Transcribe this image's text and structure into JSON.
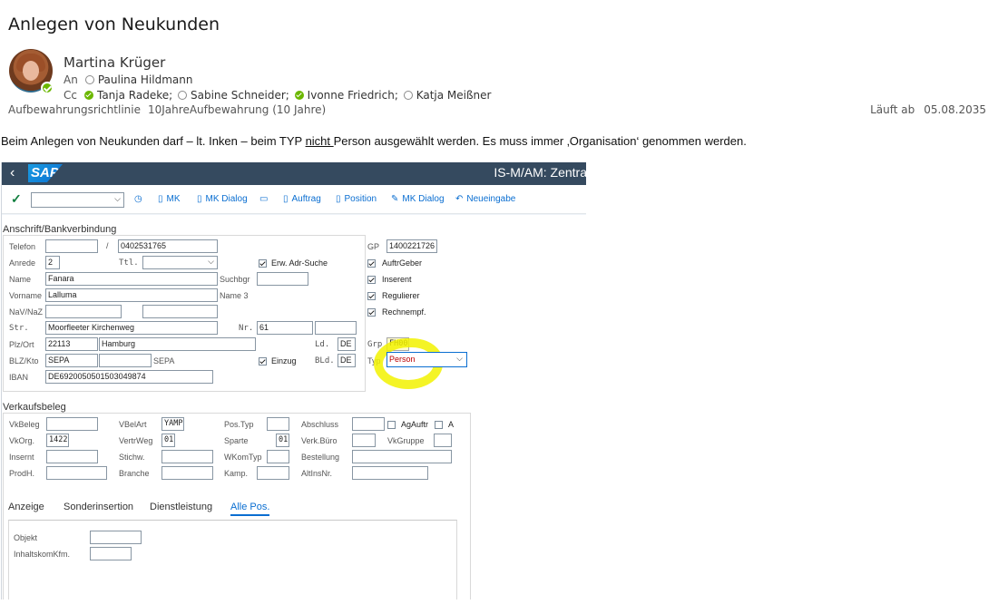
{
  "mail": {
    "subject": "Anlegen von Neukunden",
    "sender": "Martina Krüger",
    "to_label": "An",
    "cc_label": "Cc",
    "to": [
      {
        "name": "Paulina Hildmann",
        "status": "offline"
      }
    ],
    "cc": [
      {
        "name": "Tanja Radeke;",
        "status": "available"
      },
      {
        "name": "Sabine Schneider;",
        "status": "offline"
      },
      {
        "name": "Ivonne Friedrich;",
        "status": "available"
      },
      {
        "name": "Katja Meißner",
        "status": "offline"
      }
    ],
    "retention_label": "Aufbewahrungsrichtlinie",
    "retention_value": "10JahreAufbewahrung (10 Jahre)",
    "expiry_label": "Läuft ab",
    "expiry_date": "05.08.2035",
    "body_part1": "Beim Anlegen von Neukunden darf – lt. Inken – beim TYP ",
    "body_underlined": "nicht ",
    "body_part2": "Person ausgewählt werden. Es muss immer ‚Organisation‘ genommen werden."
  },
  "sap": {
    "logo": "SAP",
    "title": "IS-M/AM: Zentra",
    "toolbar": {
      "mk": "MK",
      "mk_dialog": "MK Dialog",
      "auftrag": "Auftrag",
      "position": "Position",
      "mk_dialog2": "MK Dialog",
      "neueingabe": "Neueingabe"
    },
    "address": {
      "section_title": "Anschrift/Bankverbindung",
      "telefon_label": "Telefon",
      "telefon_sep": "/",
      "telefon_value": "0402531765",
      "anrede_label": "Anrede",
      "anrede_value": "2",
      "ttl_label": "Ttl.",
      "erw_adr_suche": "Erw. Adr-Suche",
      "name_label": "Name",
      "name_value": "Fanara",
      "suchbgr_label": "Suchbgr",
      "vorname_label": "Vorname",
      "vorname_value": "Lalluma",
      "name3_label": "Name 3",
      "navnaz_label": "NaV/NaZ",
      "str_label": "Str.",
      "str_value": "Moorfleeter Kirchenweg",
      "nr_label": "Nr.",
      "nr_value": "61",
      "plzort_label": "Plz/Ort",
      "plz_value": "22113",
      "ort_value": "Hamburg",
      "ld_label": "Ld.",
      "ld_value": "DE",
      "blzkto_label": "BLZ/Kto",
      "blz_value": "SEPA",
      "sepa_label": "SEPA",
      "einzug_label": "Einzug",
      "bld_label": "BLd.",
      "bld_value": "DE",
      "iban_label": "IBAN",
      "iban_value": "DE69200505015030498​74",
      "gp_label": "GP",
      "gp_value": "1400221726",
      "auftrgeber": "AuftrGeber",
      "inserent": "Inserent",
      "regulierer": "Regulierer",
      "rechnempf": "Rechnempf.",
      "grp_label": "Grp",
      "grp_value": "FH00",
      "typ_label": "Typ",
      "typ_value": "Person"
    },
    "sales": {
      "section_title": "Verkaufsbeleg",
      "vkbeleg": "VkBeleg",
      "vbelart": "VBelArt",
      "vbelart_value": "YAMP",
      "postyp": "Pos.Typ",
      "abschluss": "Abschluss",
      "agauftr": "AgAuftr",
      "a_label": "A",
      "vkorg": "VkOrg.",
      "vkorg_value": "1422",
      "vertrweg": "VertrWeg",
      "vertrweg_value": "01",
      "sparte": "Sparte",
      "sparte_value": "01",
      "verkbuero": "Verk.Büro",
      "vkgruppe": "VkGruppe",
      "insernt": "Insernt",
      "stichw": "Stichw.",
      "wkomtyp": "WKomTyp",
      "bestellung": "Bestellung",
      "prodh": "ProdH.",
      "branche": "Branche",
      "kamp": "Kamp.",
      "altinsnr": "AltInsNr."
    },
    "tabs": [
      "Anzeige",
      "Sonderinsertion",
      "Dienstleistung",
      "Alle Pos."
    ],
    "panel": {
      "objekt": "Objekt",
      "inhaltskom": "InhaltskomKfm."
    }
  }
}
